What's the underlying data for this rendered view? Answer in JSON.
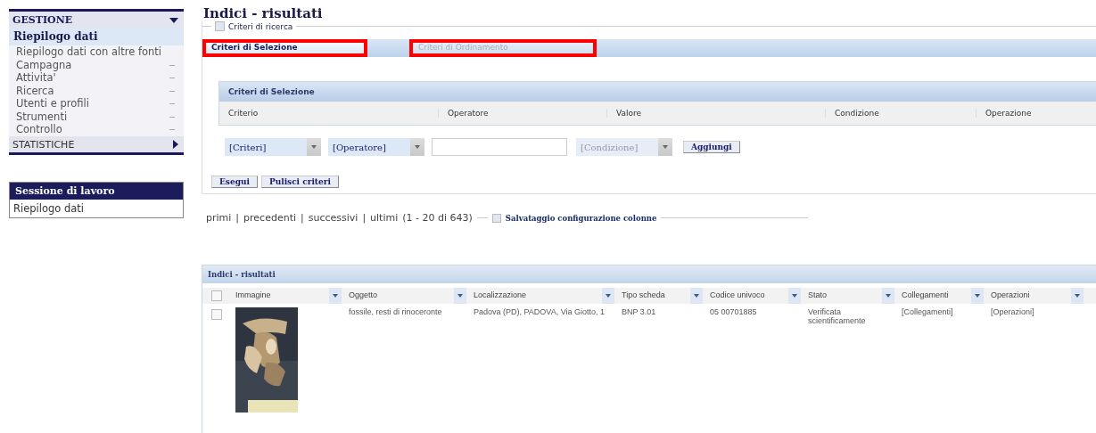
{
  "sidebar": {
    "section": "GESTIONE",
    "section_expanded": true,
    "items": [
      {
        "label": "Riepilogo dati",
        "selected": true,
        "expandable": false
      },
      {
        "label": "Riepilogo dati con altre fonti",
        "selected": false,
        "expandable": false
      },
      {
        "label": "Campagna",
        "selected": false,
        "expandable": true
      },
      {
        "label": "Attivita'",
        "selected": false,
        "expandable": true
      },
      {
        "label": "Ricerca",
        "selected": false,
        "expandable": true
      },
      {
        "label": "Utenti e profili",
        "selected": false,
        "expandable": true
      },
      {
        "label": "Strumenti",
        "selected": false,
        "expandable": true
      },
      {
        "label": "Controllo",
        "selected": false,
        "expandable": true
      }
    ],
    "section2": "STATISTICHE",
    "section2_expanded": false
  },
  "session": {
    "title": "Sessione di lavoro",
    "items": [
      "Riepilogo dati"
    ]
  },
  "page_title": "Indici - risultati",
  "search_legend": "Criteri di ricerca",
  "tabs": [
    {
      "label": "Criteri di Selezione",
      "selected": true,
      "highlighted": true
    },
    {
      "label": "Criteri di Ordinamento",
      "selected": false,
      "highlighted": true
    }
  ],
  "criteria": {
    "title": "Criteri di Selezione",
    "columns": [
      "Criterio",
      "Operatore",
      "Valore",
      "Condizione",
      "Operazione"
    ],
    "criterion_select": "[Criteri]",
    "operator_select": "[Operatore]",
    "condition_select": "[Condizione]",
    "condition_disabled": true,
    "add_button": "Aggiungi"
  },
  "action_buttons": [
    "Esegui",
    "Pulisci criteri"
  ],
  "pager": {
    "links": [
      "primi",
      "precedenti",
      "successivi",
      "ultimi"
    ],
    "separator": "|",
    "range": "(1 - 20 di 643)"
  },
  "save_config": "Salvataggio configurazione colonne",
  "results": {
    "title": "Indici - risultati",
    "all_checked": false,
    "columns": [
      "Immagine",
      "Oggetto",
      "Localizzazione",
      "Tipo scheda",
      "Codice univoco",
      "Stato",
      "Collegamenti",
      "Operazioni"
    ],
    "rows": [
      {
        "checked": false,
        "oggetto": "fossile, resti di rinoceronte",
        "localizzazione": "Padova (PD), PADOVA, Via Giotto, 1",
        "tipo_scheda": "BNP 3.01",
        "codice": "05 00701885",
        "stato": "Verificata scientificamente",
        "collegamenti": "[Collegamenti]",
        "operazioni": "[Operazioni]"
      }
    ]
  }
}
